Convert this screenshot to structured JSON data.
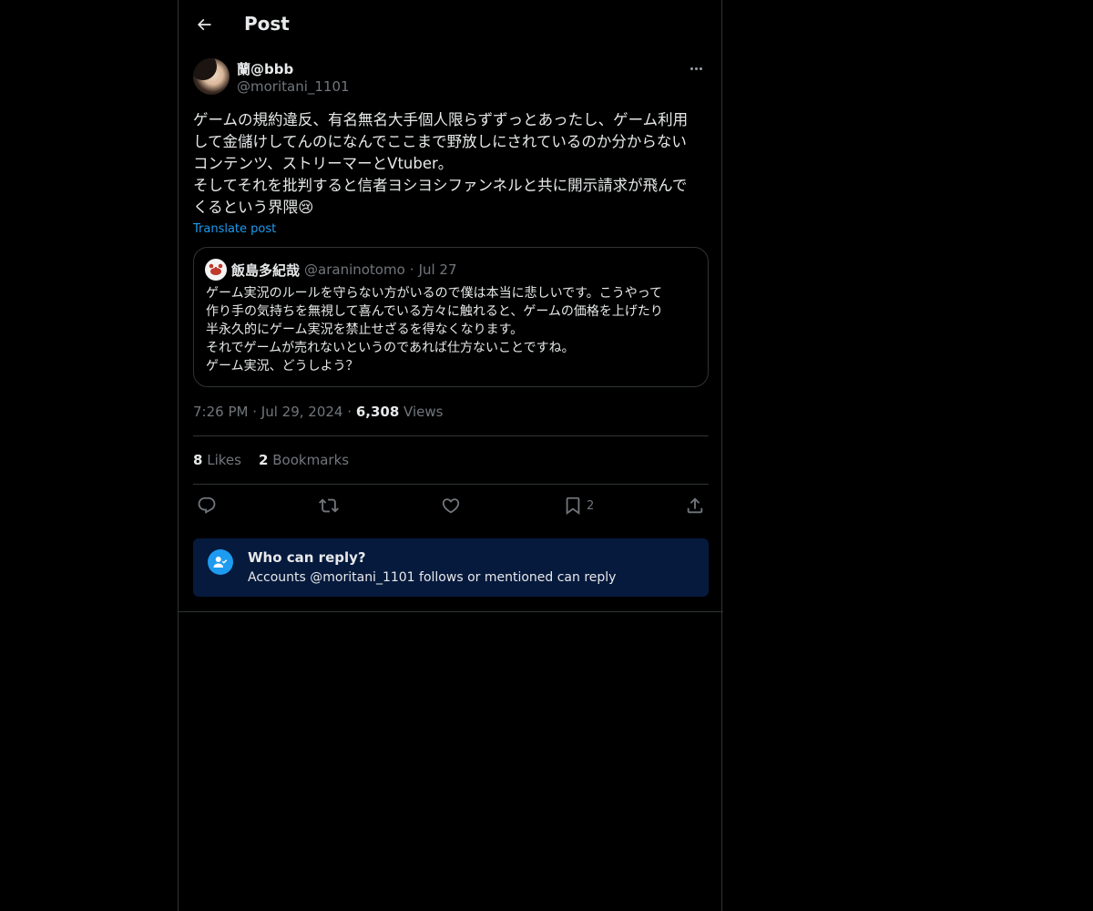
{
  "header": {
    "title": "Post",
    "back_icon": "arrow-left-icon"
  },
  "post": {
    "display_name": "蘭@bbb",
    "handle": "@moritani_1101",
    "text": "ゲームの規約違反、有名無名大手個人限らずずっとあったし、ゲーム利用\nして金儲けしてんのになんでここまで野放しにされているのか分からない\nコンテンツ、ストリーマーとVtuber。\nそしてそれを批判すると信者ヨシヨシファンネルと共に開示請求が飛んで\nくるという界隈😢",
    "translate_label": "Translate post",
    "time": "7:26 PM",
    "date": "Jul 29, 2024",
    "views_count": "6,308",
    "views_label": "Views",
    "separator": "·"
  },
  "quote": {
    "display_name": "飯島多紀哉",
    "handle": "@araninotomo",
    "separator": "·",
    "date": "Jul 27",
    "avatar_icon": "crab-icon",
    "text": "ゲーム実況のルールを守らない方がいるので僕は本当に悲しいです。こうやって\n作り手の気持ちを無視して喜んでいる方々に触れると、ゲームの価格を上げたり\n半永久的にゲーム実況を禁止せざるを得なくなります。\nそれでゲームが売れないというのであれば仕方ないことですね。\nゲーム実況、どうしよう？"
  },
  "stats": {
    "likes_count": "8",
    "likes_label": "Likes",
    "bookmarks_count": "2",
    "bookmarks_label": "Bookmarks"
  },
  "actions": {
    "reply_icon": "reply-icon",
    "repost_icon": "repost-icon",
    "like_icon": "heart-icon",
    "bookmark_icon": "bookmark-icon",
    "bookmark_count": "2",
    "share_icon": "share-icon"
  },
  "reply_restriction": {
    "title": "Who can reply?",
    "subtitle": "Accounts @moritani_1101 follows or mentioned can reply",
    "icon": "person-check-icon"
  },
  "colors": {
    "background": "#000000",
    "text": "#e7e9ea",
    "muted": "#71767b",
    "accent": "#1d9bf0",
    "border": "#2f3336",
    "notice_bg": "#061a3d"
  }
}
